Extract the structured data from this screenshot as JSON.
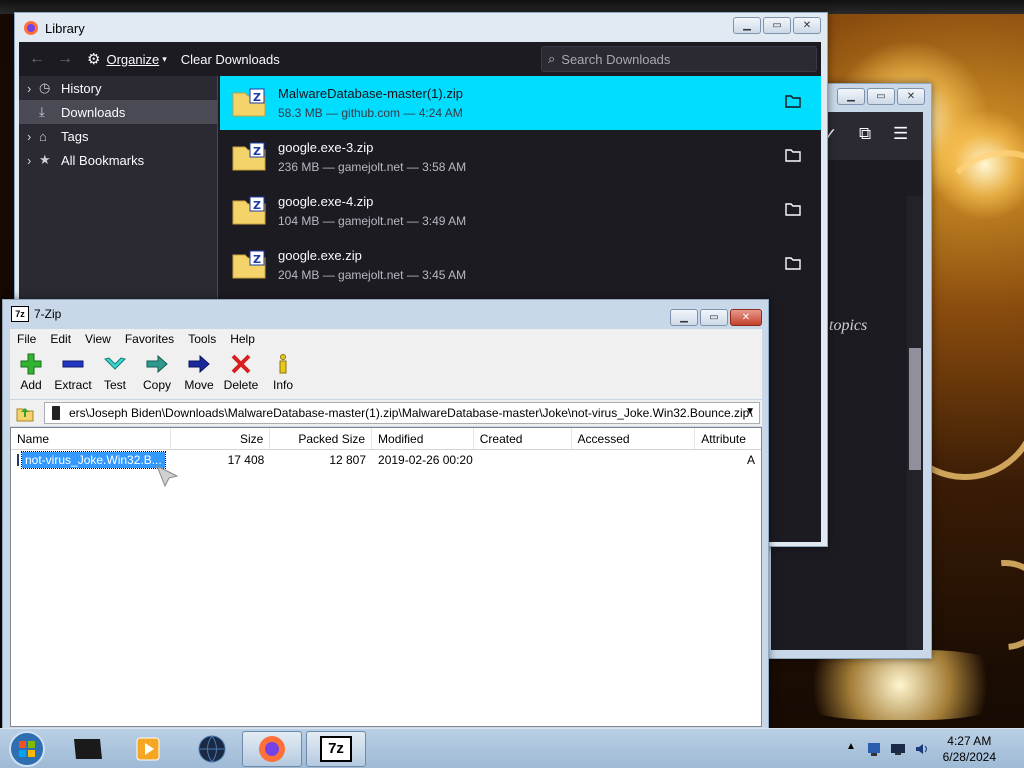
{
  "library": {
    "title": "Library",
    "toolbar": {
      "organize_label": "Organize",
      "clear_label": "Clear Downloads",
      "search_placeholder": "Search Downloads"
    },
    "sidebar": [
      {
        "label": "History",
        "icon": "clock-icon"
      },
      {
        "label": "Downloads",
        "icon": "download-icon",
        "selected": true
      },
      {
        "label": "Tags",
        "icon": "tag-icon"
      },
      {
        "label": "All Bookmarks",
        "icon": "star-icon"
      }
    ],
    "downloads": [
      {
        "name": "MalwareDatabase-master(1).zip",
        "meta": "58.3 MB — github.com — 4:24 AM",
        "selected": true
      },
      {
        "name": "google.exe-3.zip",
        "meta": "236 MB — gamejolt.net — 3:58 AM"
      },
      {
        "name": "google.exe-4.zip",
        "meta": "104 MB — gamejolt.net — 3:49 AM"
      },
      {
        "name": "google.exe.zip",
        "meta": "204 MB — gamejolt.net — 3:45 AM"
      }
    ]
  },
  "browser_back": {
    "topics_text": "topics"
  },
  "zip": {
    "title": "7-Zip",
    "menu": [
      "File",
      "Edit",
      "View",
      "Favorites",
      "Tools",
      "Help"
    ],
    "tools": [
      "Add",
      "Extract",
      "Test",
      "Copy",
      "Move",
      "Delete",
      "Info"
    ],
    "path": "ers\\Joseph Biden\\Downloads\\MalwareDatabase-master(1).zip\\MalwareDatabase-master\\Joke\\not-virus_Joke.Win32.Bounce.zip\\",
    "columns": [
      "Name",
      "Size",
      "Packed Size",
      "Modified",
      "Created",
      "Accessed",
      "Attribute"
    ],
    "rows": [
      {
        "name": "not-virus_Joke.Win32.B...",
        "size": "17 408",
        "packed": "12 807",
        "modified": "2019-02-26 00:20",
        "created": "",
        "accessed": "",
        "attr": "A"
      }
    ]
  },
  "taskbar": {
    "apps": [
      "start-orb",
      "terminal",
      "media-player",
      "globe",
      "firefox",
      "7zip"
    ],
    "clock_time": "4:27 AM",
    "clock_date": "6/28/2024"
  },
  "colors": {
    "selection_cyan": "#00ddff",
    "dark_bg": "#1c1b22",
    "zip_select": "#3399ff"
  }
}
